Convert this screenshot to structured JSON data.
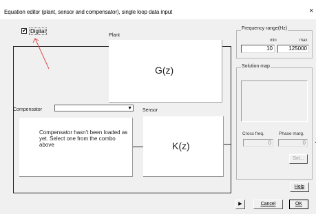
{
  "window": {
    "title": "Equation editor (plant, sensor and compensator), single loop data input",
    "close_glyph": "×"
  },
  "digital": {
    "label": "Digital",
    "checked": true,
    "check_glyph": "✔"
  },
  "plant": {
    "label": "Plant",
    "transfer_function": "G(z)"
  },
  "sensor": {
    "label": "Sensor",
    "transfer_function": "K(z)"
  },
  "compensator": {
    "label": "Compensator",
    "selected_value": "",
    "dropdown_glyph": "▼",
    "message": "Compensator hasn't been loaded as yet. Select one from the combo above"
  },
  "frequency_range": {
    "title": "Frequency range(Hz)",
    "min_label": "min",
    "max_label": "max",
    "min_value": "10",
    "max_value": "125000"
  },
  "solution_map": {
    "title": "Solution map",
    "cross_freq_label": "Cross freq.",
    "phase_marg_label": "Phase marg.",
    "cross_freq_value": "0",
    "phase_marg_value": "0",
    "set_button": "Set..."
  },
  "buttons": {
    "help": "Help",
    "play": "▶",
    "cancel": "Cancel",
    "ok": "OK"
  },
  "colors": {
    "annotation": "#e05050",
    "dialog_bg": "#f0f0f0"
  }
}
